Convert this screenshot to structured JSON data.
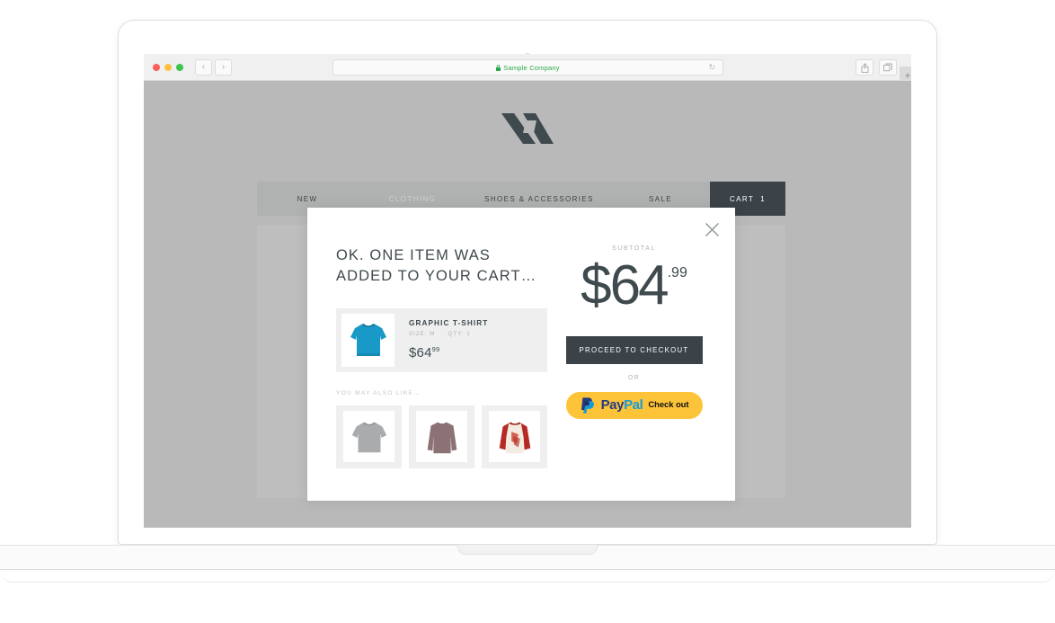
{
  "browser": {
    "url_text": "Sample Company",
    "lock_icon": "lock-icon",
    "reload_icon": "↻",
    "back_icon": "‹",
    "forward_icon": "›",
    "share_icon": "share-icon",
    "tabs_icon": "tabs-icon",
    "newtab_label": "+"
  },
  "site": {
    "logo_name": "brand-logo",
    "nav": [
      {
        "label": "NEW",
        "state": "default"
      },
      {
        "label": "CLOTHING",
        "state": "muted"
      },
      {
        "label": "SHOES & ACCESSORIES",
        "state": "default"
      },
      {
        "label": "SALE",
        "state": "default"
      }
    ],
    "cart": {
      "label": "CART",
      "count": "1"
    }
  },
  "modal": {
    "close_icon": "close-icon",
    "headline": "OK. ONE ITEM WAS ADDED TO YOUR CART…",
    "cart_item": {
      "title": "GRAPHIC T-SHIRT",
      "size": "SIZE: M",
      "qty": "QTY: 1",
      "price_main": "$64",
      "price_cents": "99",
      "thumb_name": "cyan-tshirt-thumbnail",
      "thumb_color": "#1899c8"
    },
    "also_like_label": "YOU MAY ALSO LIKE…",
    "recommendations": [
      {
        "name": "gray-tshirt-thumbnail",
        "color": "#a9abad"
      },
      {
        "name": "mauve-longsleeve-thumbnail",
        "color": "#8c7275"
      },
      {
        "name": "red-raglan-thumbnail",
        "color": "#b52b24"
      }
    ],
    "subtotal": {
      "label": "SUBTOTAL",
      "currency": "$",
      "amount": "64",
      "cents": ".99"
    },
    "checkout_label": "PROCEED TO CHECKOUT",
    "or_label": "OR",
    "paypal": {
      "pay": "Pay",
      "pal": "Pal",
      "action": "Check out",
      "bg_color": "#fdc439",
      "pay_color": "#253b80",
      "pal_color": "#179bd7"
    }
  },
  "colors": {
    "dark": "#3b4348",
    "page_bg": "#b9b9b9",
    "panel_bg": "#bebebe",
    "nav_bg": "#b0b2b2",
    "item_bg": "#efefef"
  }
}
